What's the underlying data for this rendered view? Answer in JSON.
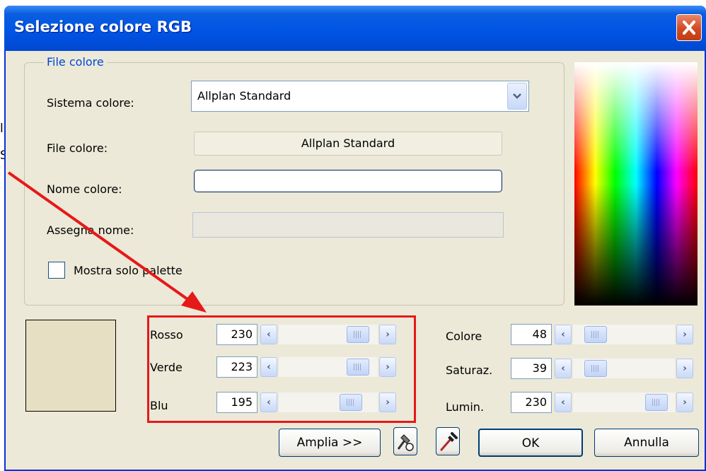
{
  "dialog": {
    "title": "Selezione colore RGB",
    "close_icon": "close-icon",
    "title_bar_color": "#0055e5",
    "background_color": "#ece9d8"
  },
  "background_fragment": {
    "line1": "li",
    "line2": "S"
  },
  "file_group": {
    "legend": "File colore",
    "color_system_label": "Sistema colore:",
    "color_system_value": "Allplan Standard",
    "color_file_label": "File colore:",
    "color_file_value": "Allplan Standard",
    "color_name_label": "Nome colore:",
    "color_name_value": "",
    "assign_name_label": "Assegna nome:",
    "assign_name_value": "",
    "show_palette_label": "Mostra solo palette",
    "show_palette_checked": false
  },
  "preview": {
    "color": "#e6dfc3"
  },
  "rgb": [
    {
      "label": "Rosso",
      "value": "230",
      "level": 0.9
    },
    {
      "label": "Verde",
      "value": "223",
      "level": 0.87
    },
    {
      "label": "Blu",
      "value": "195",
      "level": 0.76
    }
  ],
  "hsl": [
    {
      "label": "Colore",
      "value": "48",
      "level": 0.19
    },
    {
      "label": "Saturaz.",
      "value": "39",
      "level": 0.15
    },
    {
      "label": "Lumin.",
      "value": "230",
      "level": 0.9
    }
  ],
  "buttons": {
    "expand": "Amplia >>",
    "ok": "OK",
    "cancel": "Annulla"
  },
  "annotation_color": "#e61919"
}
